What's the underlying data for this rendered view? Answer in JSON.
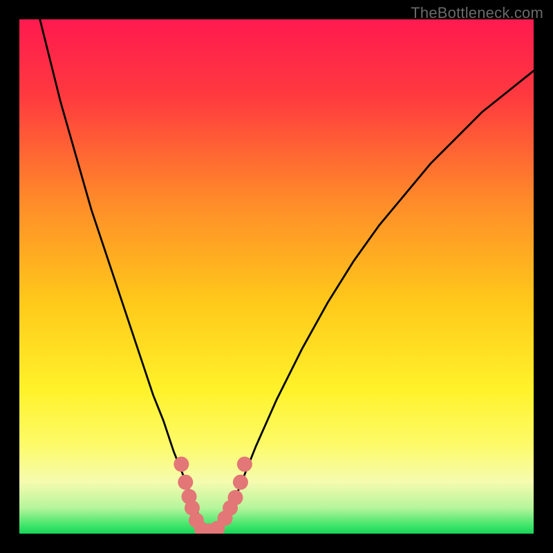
{
  "watermark": "TheBottleneck.com",
  "chart_data": {
    "type": "line",
    "title": "",
    "xlabel": "",
    "ylabel": "",
    "xlim": [
      0,
      100
    ],
    "ylim": [
      0,
      100
    ],
    "grid": false,
    "series": [
      {
        "name": "curve",
        "x": [
          4,
          6,
          8,
          10,
          12,
          14,
          16,
          18,
          20,
          22,
          24,
          26,
          28,
          30,
          32,
          34,
          35,
          36,
          38,
          40,
          42,
          44,
          46,
          50,
          55,
          60,
          65,
          70,
          75,
          80,
          85,
          90,
          95,
          100
        ],
        "values": [
          100,
          92,
          84,
          77,
          70,
          63,
          57,
          51,
          45,
          39,
          33,
          27,
          22,
          16,
          11,
          6,
          3,
          0.5,
          0.5,
          3,
          7,
          12,
          17,
          26,
          36,
          45,
          53,
          60,
          66,
          72,
          77,
          82,
          86,
          90
        ],
        "color": "#000000",
        "stroke_width": 2.8
      }
    ],
    "markers": [
      {
        "x": 31.5,
        "y": 13.5
      },
      {
        "x": 32.3,
        "y": 10.0
      },
      {
        "x": 33.0,
        "y": 7.2
      },
      {
        "x": 33.6,
        "y": 5.0
      },
      {
        "x": 34.4,
        "y": 2.6
      },
      {
        "x": 35.5,
        "y": 0.8
      },
      {
        "x": 37.0,
        "y": 0.5
      },
      {
        "x": 38.5,
        "y": 1.0
      },
      {
        "x": 40.0,
        "y": 3.0
      },
      {
        "x": 41.0,
        "y": 5.0
      },
      {
        "x": 42.0,
        "y": 7.0
      },
      {
        "x": 43.0,
        "y": 10.0
      },
      {
        "x": 43.8,
        "y": 13.5
      }
    ],
    "marker_style": {
      "color": "#e37676",
      "radius": 11
    }
  },
  "colors": {
    "background_top": "#ff1a4f",
    "background_bottom": "#18d458",
    "curve": "#000000",
    "markers": "#e37676",
    "frame": "#000000",
    "watermark": "#6a6a6a"
  }
}
